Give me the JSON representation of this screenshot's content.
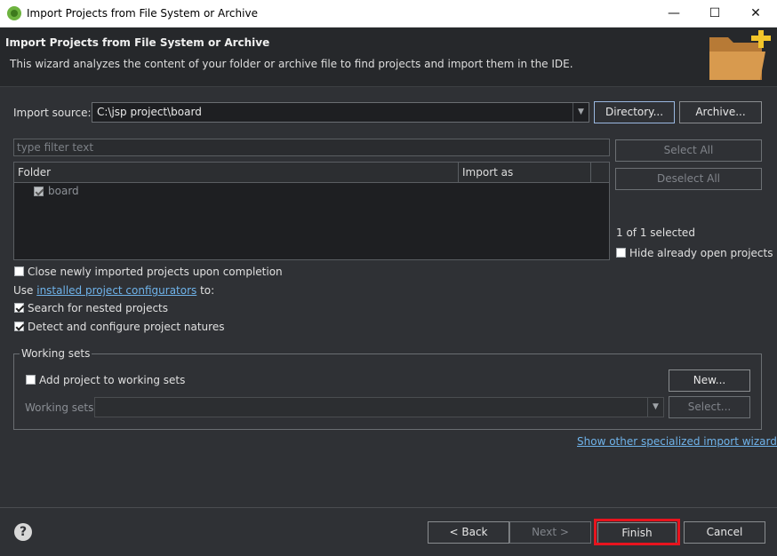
{
  "window": {
    "title": "Import Projects from File System or Archive",
    "minimize": "—",
    "maximize": "☐",
    "close": "✕"
  },
  "header": {
    "title": "Import Projects from File System or Archive",
    "description": "This wizard analyzes the content of your folder or archive file to find projects and import them in the IDE."
  },
  "source": {
    "label": "Import source:",
    "value": "C:\\jsp project\\board",
    "directory_button": "Directory...",
    "archive_button": "Archive..."
  },
  "filter": {
    "placeholder": "type filter text"
  },
  "table": {
    "columns": [
      "Folder",
      "Import as"
    ],
    "rows": [
      {
        "folder": "board",
        "checked": true
      }
    ]
  },
  "side": {
    "select_all": "Select All",
    "deselect_all": "Deselect All",
    "selected_count": "1 of 1 selected",
    "hide_open": "Hide already open projects"
  },
  "options": {
    "close_imported": "Close newly imported projects upon completion",
    "use_prefix": "Use ",
    "configurators_link": "installed project configurators",
    "use_suffix": " to:",
    "search_nested": "Search for nested projects",
    "detect_natures": "Detect and configure project natures"
  },
  "working_sets": {
    "legend": "Working sets",
    "add_label": "Add project to working sets",
    "new_button": "New...",
    "sets_label": "Working sets:",
    "select_button": "Select..."
  },
  "specialized_link": "Show other specialized import wizards",
  "footer": {
    "back": "< Back",
    "next": "Next >",
    "finish": "Finish",
    "cancel": "Cancel"
  },
  "colors": {
    "background": "#2f3135",
    "header": "#26282b",
    "link": "#6fb3ea",
    "highlight": "#e8141e",
    "folder_icon": "#d89a4e",
    "plus": "#f2c52a"
  }
}
